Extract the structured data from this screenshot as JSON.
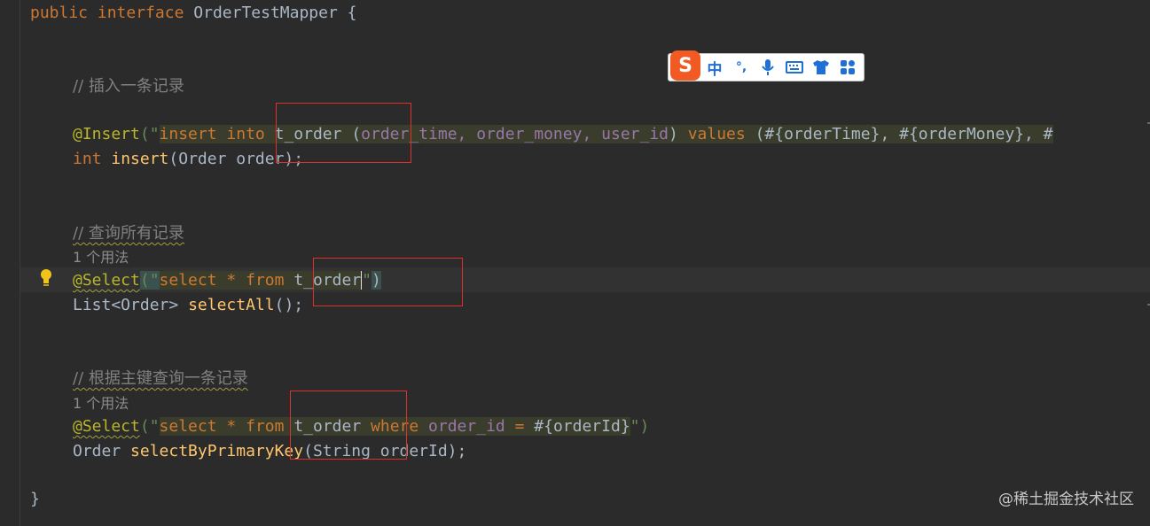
{
  "editor": {
    "interface_decl": {
      "public": "public",
      "interface": "interface",
      "name": "OrderTestMapper",
      "brace": "{"
    },
    "comment_insert": "// 插入一条记录",
    "insert": {
      "annotation": "@Insert",
      "open": "(\"",
      "sql_insert": "insert",
      "sql_into": "into",
      "table": "t_order",
      "paren_open": "(",
      "col1": "order_time",
      "col2": "order_money",
      "col3": "user_id",
      "paren_close": ")",
      "values": "values",
      "params": "(#{orderTime}, #{orderMoney}, #",
      "method_type": "int",
      "method_name": "insert",
      "method_args": "(Order order);"
    },
    "comment_select_all": "// 查询所有记录",
    "usage_1": "1 个用法",
    "select_all": {
      "annotation": "@Select",
      "open": "(\"",
      "sql_select": "select",
      "star": "*",
      "from": "from",
      "table": "t_order",
      "close_quote": "\"",
      "close": ")",
      "return_type": "List<Order>",
      "method_name": "selectAll",
      "method_args": "();"
    },
    "comment_select_pk": "// 根据主键查询一条记录",
    "usage_2": "1 个用法",
    "select_pk": {
      "annotation": "@Select",
      "open": "(\"",
      "sql_select": "select",
      "star": "*",
      "from": "from",
      "table": "t_order",
      "where": "where",
      "column": "order_id",
      "eq": "=",
      "param": "#{orderId}",
      "close": "\")",
      "return_type": "Order",
      "method_name": "selectByPrimaryKey",
      "method_args": "(String orderId);"
    },
    "closing_brace": "}"
  },
  "ime_toolbar": {
    "logo": "S",
    "mode": "中",
    "punct": "°,",
    "icons": [
      "microphone-icon",
      "keyboard-icon",
      "shirt-icon",
      "grid-icon"
    ]
  },
  "watermark": "@稀土掘金技术社区",
  "colors": {
    "background": "#2b2b2b",
    "keyword": "#cc7832",
    "annotation": "#bbb529",
    "string": "#6a8759",
    "method": "#ffc66d",
    "column": "#9876aa",
    "highlight_box": "#e0302a"
  }
}
